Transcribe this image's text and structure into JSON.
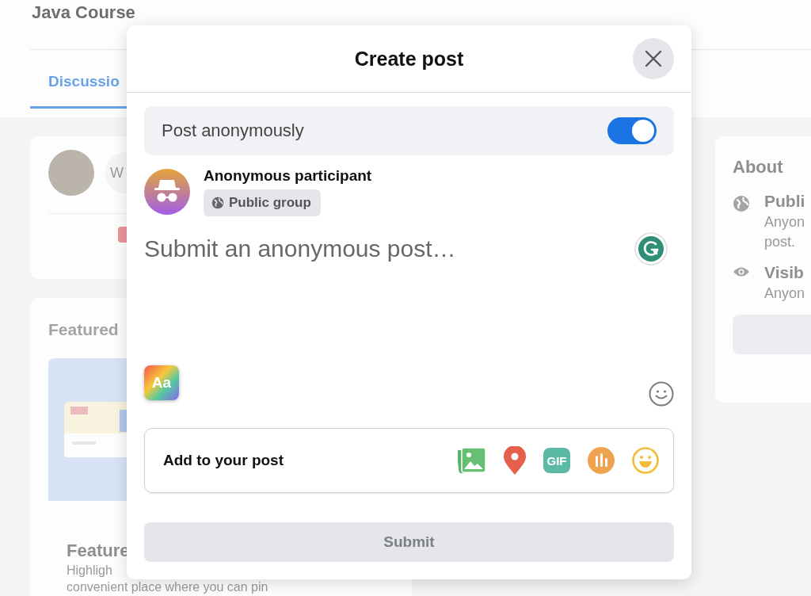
{
  "page": {
    "title": "Java Course",
    "tabs": [
      {
        "label": "Discussio",
        "selected": true
      }
    ],
    "composer": {
      "placeholder": "W"
    },
    "featured": {
      "heading": "Featured",
      "card_title": "Feature",
      "card_lines": [
        "Highligh",
        "convenient place where you can pin"
      ]
    },
    "about": {
      "heading": "About",
      "items": [
        {
          "kind": "globe",
          "title": "Publi",
          "lines": [
            "Anyon",
            "post."
          ]
        },
        {
          "kind": "eye",
          "title": "Visib",
          "lines": [
            "Anyon"
          ]
        }
      ]
    }
  },
  "dialog": {
    "title": "Create post",
    "anonymous_toggle": {
      "label": "Post anonymously",
      "on": true
    },
    "author": {
      "name": "Anonymous participant",
      "audience": "Public group"
    },
    "editor": {
      "placeholder": "Submit an anonymous post…"
    },
    "text_format": "Aa",
    "add_to_post": {
      "label": "Add to your post",
      "tools": [
        {
          "kind": "photo"
        },
        {
          "kind": "location"
        },
        {
          "kind": "gif",
          "text": "GIF"
        },
        {
          "kind": "poll"
        },
        {
          "kind": "feeling"
        }
      ]
    },
    "submit": {
      "label": "Submit",
      "disabled": true
    }
  }
}
